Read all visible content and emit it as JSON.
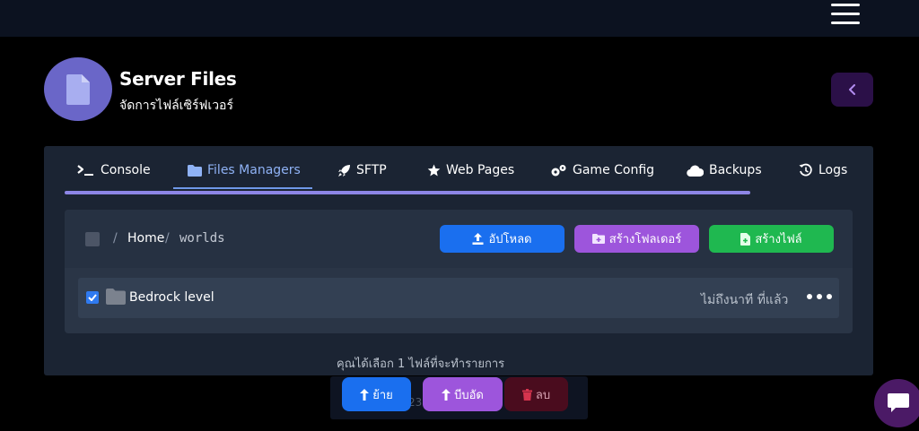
{
  "header": {
    "title": "Server Files",
    "subtitle": "จัดการไฟล์เซิร์ฟเวอร์",
    "icon": "file-icon",
    "back_icon": "chevron-left-icon",
    "menu_icon": "hamburger-icon"
  },
  "tabs": [
    {
      "label": "Console",
      "icon": "terminal-icon",
      "active": false
    },
    {
      "label": "Files Managers",
      "icon": "folder-icon",
      "active": true
    },
    {
      "label": "SFTP",
      "icon": "rocket-icon",
      "active": false
    },
    {
      "label": "Web Pages",
      "icon": "star-icon",
      "active": false
    },
    {
      "label": "Game Config",
      "icon": "gears-icon",
      "active": false
    },
    {
      "label": "Backups",
      "icon": "cloud-icon",
      "active": false
    },
    {
      "label": "Logs",
      "icon": "history-icon",
      "active": false
    }
  ],
  "breadcrumb": {
    "home": "Home",
    "current": "worlds",
    "separator": "/"
  },
  "toolbar": {
    "upload_label": "อัปโหลด",
    "new_folder_label": "สร้างโฟลเดอร์",
    "new_file_label": "สร้างไฟล์"
  },
  "files": [
    {
      "name": "Bedrock level",
      "type": "folder",
      "modified": "ไม่ถึงนาที ที่แล้ว",
      "checked": true
    }
  ],
  "selection": {
    "message": "คุณได้เลือก 1 ไฟล์ที่จะทำรายการ",
    "move_label": "ย้าย",
    "zip_label": "บีบอัด",
    "delete_label": "ลบ"
  },
  "footer": {
    "partial_text": "23"
  },
  "colors": {
    "accent": "#8d86e6",
    "upload": "#1a6fef",
    "new_folder": "#9d55dc",
    "new_file": "#1fb850",
    "delete": "#4a0c1e",
    "panel": "#1b2433"
  }
}
